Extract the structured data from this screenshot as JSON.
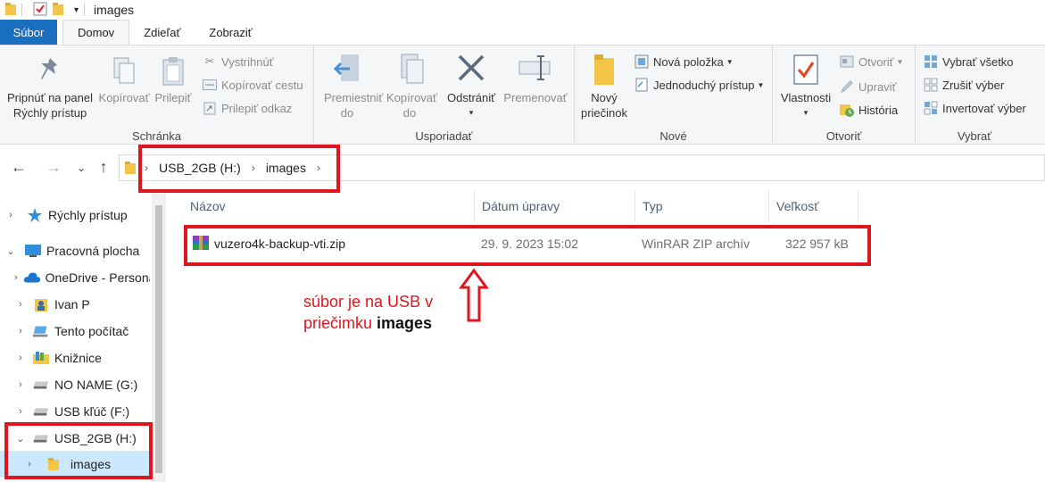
{
  "window": {
    "title": "images"
  },
  "tabs": [
    {
      "label": "Súbor"
    },
    {
      "label": "Domov"
    },
    {
      "label": "Zdieľať"
    },
    {
      "label": "Zobraziť"
    }
  ],
  "ribbon": {
    "clipboard": {
      "label": "Schránka",
      "pin": "Pripnúť na panel Rýchly prístup",
      "copy": "Kopírovať",
      "paste": "Prilepiť",
      "cut": "Vystrihnúť",
      "copy_path": "Kopírovať cestu",
      "paste_shortcut": "Prilepiť odkaz"
    },
    "organize": {
      "label": "Usporiadať",
      "move_to": "Premiestniť do",
      "copy_to": "Kopírovať do",
      "delete": "Odstrániť",
      "rename": "Premenovať"
    },
    "new": {
      "label": "Nové",
      "new_folder": "Nový priečinok",
      "new_item": "Nová položka",
      "easy_access": "Jednoduchý prístup"
    },
    "open": {
      "label": "Otvoriť",
      "properties": "Vlastnosti",
      "open": "Otvoriť",
      "edit": "Upraviť",
      "history": "História"
    },
    "select": {
      "label": "Vybrať",
      "select_all": "Vybrať všetko",
      "select_none": "Zrušiť výber",
      "invert": "Invertovať výber"
    }
  },
  "address": {
    "crumbs": [
      "USB_2GB (H:)",
      "images"
    ]
  },
  "navpane": {
    "items": [
      {
        "label": "Rýchly prístup"
      },
      {
        "label": "Pracovná plocha"
      },
      {
        "label": "OneDrive - Personal"
      },
      {
        "label": "Ivan P"
      },
      {
        "label": "Tento počítač"
      },
      {
        "label": "Knižnice"
      },
      {
        "label": "NO NAME (G:)"
      },
      {
        "label": "USB kľúč (F:)"
      },
      {
        "label": "USB_2GB (H:)"
      },
      {
        "label": "images"
      }
    ]
  },
  "filelist": {
    "columns": [
      "Názov",
      "Dátum úpravy",
      "Typ",
      "Veľkosť"
    ],
    "rows": [
      {
        "name": "vuzero4k-backup-vti.zip",
        "date": "29. 9. 2023 15:02",
        "type": "WinRAR ZIP archív",
        "size": "322 957 kB"
      }
    ]
  },
  "annotation": {
    "line1": "súbor je na USB v",
    "line2_prefix": "priečimku ",
    "line2_bold": "images",
    "color": "#e0161e"
  }
}
